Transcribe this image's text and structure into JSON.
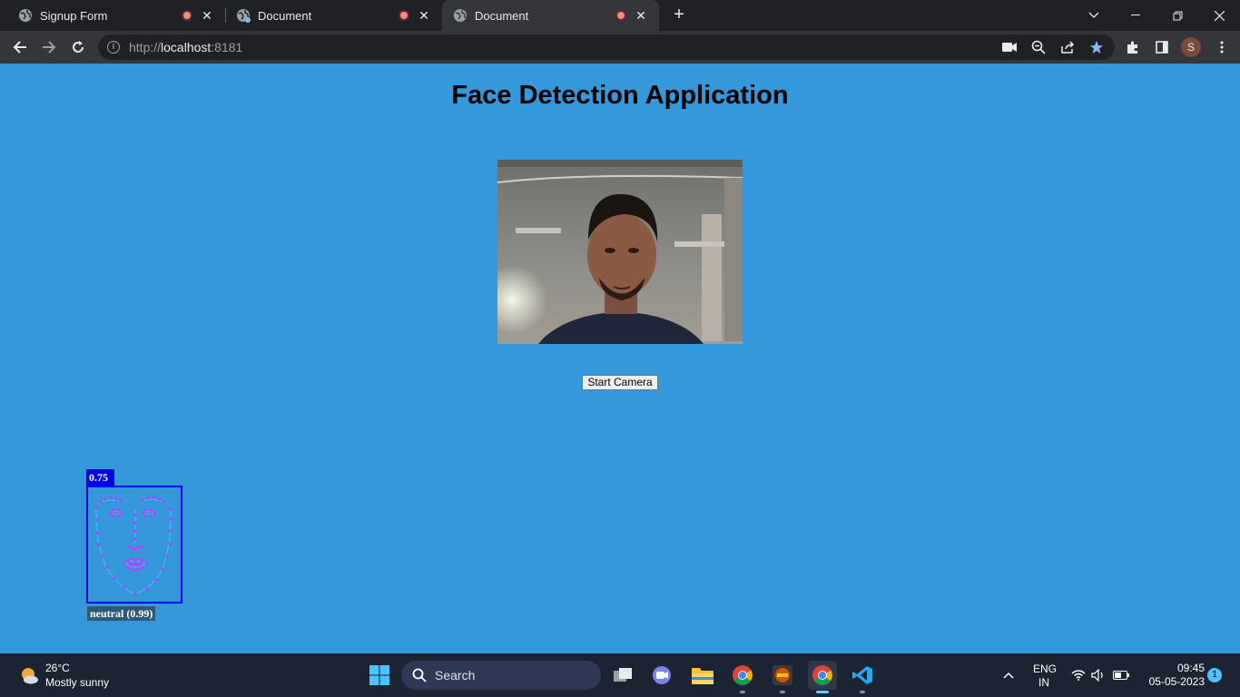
{
  "browser": {
    "tabs": [
      {
        "title": "Signup Form",
        "active": false
      },
      {
        "title": "Document",
        "active": false
      },
      {
        "title": "Document",
        "active": true
      }
    ],
    "url_prefix": "http://",
    "url_host": "localhost",
    "url_port": ":8181",
    "profile_initial": "S",
    "accent_color": "#8ab4f8"
  },
  "page": {
    "background_color": "#3498db",
    "title": "Face Detection Application",
    "start_button_label": "Start Camera",
    "detection": {
      "score": "0.75",
      "expression_label": "neutral (0.99)",
      "box_color": "#0000ff",
      "landmark_color": "#cc33ff"
    }
  },
  "taskbar": {
    "weather_temp": "26°C",
    "weather_desc": "Mostly sunny",
    "search_label": "Search",
    "language_top": "ENG",
    "language_bottom": "IN",
    "time": "09:45",
    "date": "05-05-2023",
    "notification_count": "1",
    "apps": [
      "task-view-icon",
      "teams-chat-icon",
      "file-explorer-icon",
      "chrome-icon",
      "ide-icon",
      "chrome-active-icon",
      "vscode-icon"
    ]
  }
}
